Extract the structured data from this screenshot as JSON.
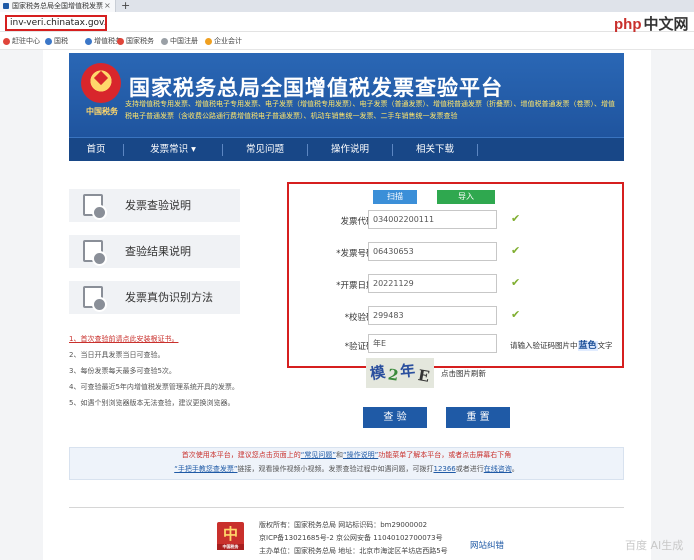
{
  "browser": {
    "tab_title": "国家税务总局全国增值税发票",
    "tab_close": "×",
    "new_tab": "+",
    "address": "inv-veri.chinatax.gov.cn/",
    "watermark_brand": "php",
    "watermark_cn": "中文网",
    "bookmarks": [
      {
        "label": "赶驻中心",
        "color": "#e0453a"
      },
      {
        "label": "国税",
        "color": "#3b77c8"
      },
      {
        "label": "增值税务",
        "color": "#3b77c8"
      },
      {
        "label": "国家税务",
        "color": "#e0453a"
      },
      {
        "label": "中国注册",
        "color": "#9aa0a6"
      },
      {
        "label": "企业会计",
        "color": "#f0a020"
      }
    ]
  },
  "header": {
    "emblem_caption": "中国税务",
    "title": "国家税务总局全国增值税发票查验平台",
    "subtitle": "支持增值税专用发票、增值税电子专用发票、电子发票（增值税专用发票）、电子发票（普通发票）、增值税普通发票（折叠票）、增值税普通发票（卷票）、增值税电子普通发票（含收费公路通行费增值税电子普通发票）、机动车销售统一发票、二手车销售统一发票查验",
    "nav": [
      {
        "label": "首页"
      },
      {
        "label": "发票常识"
      },
      {
        "label": "常见问题"
      },
      {
        "label": "操作说明"
      },
      {
        "label": "相关下载"
      }
    ],
    "dropdown_glyph": "▾"
  },
  "left_nav": [
    {
      "label": "发票查验说明"
    },
    {
      "label": "查验结果说明"
    },
    {
      "label": "发票真伪识别方法"
    }
  ],
  "notes": [
    "1、首次查验前请点此安装根证书。",
    "2、当日开具发票当日可查验。",
    "3、每份发票每天最多可查验5次。",
    "4、可查验最近5年内增值税发票管理系统开具的发票。",
    "5、如遇个别浏览器版本无法查验，建议更换浏览器。"
  ],
  "form": {
    "tabs": [
      {
        "label": "扫描",
        "color": "#3b8fd8"
      },
      {
        "label": "导入",
        "color": "#2fa84f"
      }
    ],
    "fields": [
      {
        "label": "发票代码：",
        "value": "034002200111"
      },
      {
        "label": "*发票号码：",
        "value": "06430653"
      },
      {
        "label": "*开票日期：",
        "value": "20221129"
      },
      {
        "label": "*校验码：",
        "value": "299483"
      },
      {
        "label": "*验证码：",
        "value": "年E"
      }
    ],
    "check_glyph": "✔",
    "captcha_hint_before": "请输入验证码图片中",
    "captcha_hint_color": "蓝色",
    "captcha_hint_after": "文字",
    "captcha_chars": [
      {
        "ch": "模",
        "color": "#2a4f9e"
      },
      {
        "ch": "2",
        "color": "#3a8a3a"
      },
      {
        "ch": "年",
        "color": "#2a4f9e"
      },
      {
        "ch": "E",
        "color": "#333333"
      }
    ],
    "refresh_label": "点击图片刷新",
    "submit_label": "查 验",
    "reset_label": "重 置"
  },
  "notice": {
    "line1_a": "首次使用本平台，建议您点击页面上的",
    "line1_b": "“常见问题”",
    "line1_c": "和",
    "line1_d": "“操作说明”",
    "line1_e": "功能菜单了解本平台，或者点击屏幕右下角",
    "line2_a": "“手把手教您查发票”",
    "line2_b": "链接，观看操作视频小视频。发票查验过程中如遇问题，可拨打",
    "line2_c": "12366",
    "line2_d": "或者进行",
    "line2_e": "在线咨询",
    "line2_f": "。"
  },
  "footer": {
    "logo_glyph": "中",
    "logo_caption": "中国税务",
    "line1": "版权所有：国家税务总局  网站标识码：bm29000002",
    "line2": "京ICP备13021685号-2  京公网安备 11040102700073号",
    "line3": "主办单位：国家税务总局  地址：北京市海淀区羊坊店西路5号",
    "site_link": "网站纠错",
    "ai_mark": "百度 AI生成"
  }
}
